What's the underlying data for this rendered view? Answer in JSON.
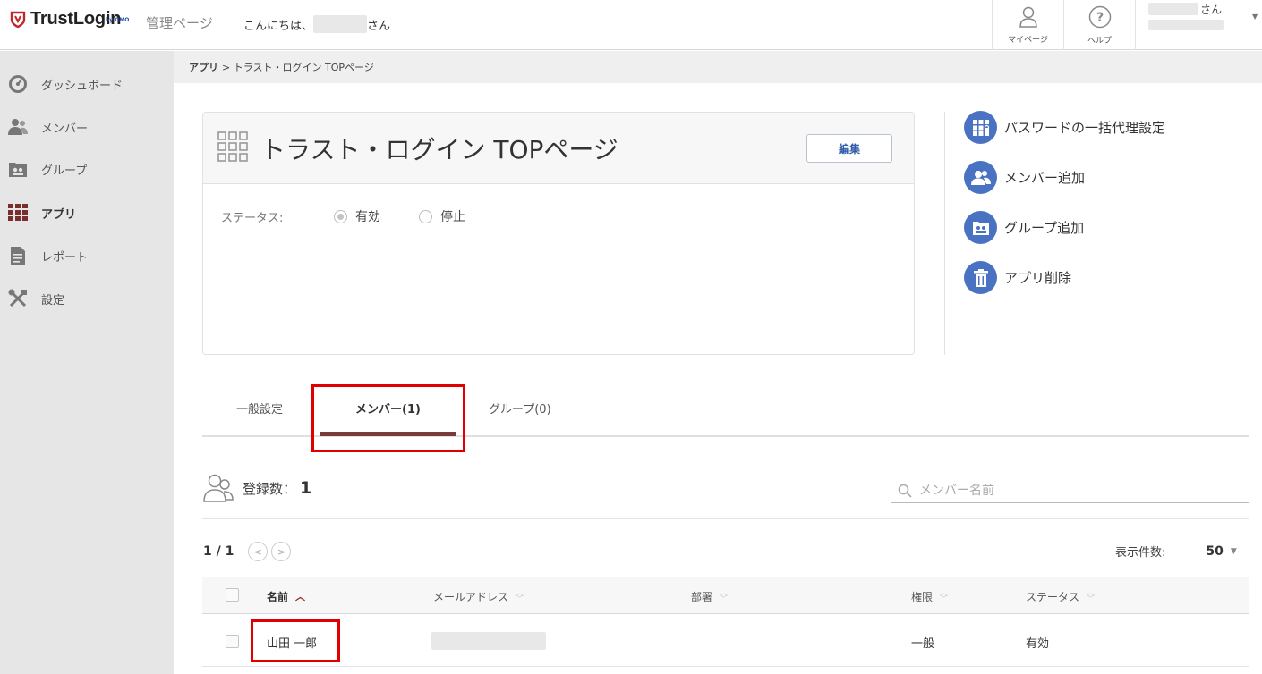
{
  "header": {
    "brand": "TrustLogin",
    "brand_sub": "by GMO",
    "admin_label": "管理ページ",
    "greeting_prefix": "こんにちは、",
    "greeting_suffix": "さん",
    "mypage_label": "マイページ",
    "help_label": "ヘルプ",
    "user_suffix": "さん"
  },
  "sidebar": {
    "items": [
      {
        "label": "ダッシュボード",
        "icon": "dashboard-icon"
      },
      {
        "label": "メンバー",
        "icon": "members-icon"
      },
      {
        "label": "グループ",
        "icon": "group-icon"
      },
      {
        "label": "アプリ",
        "icon": "apps-grid-icon",
        "active": true
      },
      {
        "label": "レポート",
        "icon": "report-icon"
      },
      {
        "label": "設定",
        "icon": "settings-tools-icon"
      }
    ]
  },
  "breadcrumb": {
    "parent": "アプリ",
    "current": "> トラスト・ログイン TOPページ"
  },
  "app": {
    "title": "トラスト・ログイン TOPページ",
    "edit_label": "編集",
    "status_label": "ステータス:",
    "status_options": [
      "有効",
      "停止"
    ],
    "status_selected": "有効"
  },
  "actions": [
    {
      "label": "パスワードの一括代理設定",
      "icon": "bulk-password-icon"
    },
    {
      "label": "メンバー追加",
      "icon": "add-member-icon"
    },
    {
      "label": "グループ追加",
      "icon": "add-group-icon"
    },
    {
      "label": "アプリ削除",
      "icon": "trash-icon"
    }
  ],
  "tabs": [
    {
      "label": "一般設定"
    },
    {
      "label": "メンバー(1)",
      "active": true
    },
    {
      "label": "グループ(0)"
    }
  ],
  "registration": {
    "label": "登録数：",
    "count": "1"
  },
  "search": {
    "placeholder": "メンバー名前"
  },
  "pager": {
    "page": "1 / 1",
    "prev": "<",
    "next": ">",
    "per_page_label": "表示件数:",
    "per_page_value": "50"
  },
  "table": {
    "columns": [
      "名前",
      "メールアドレス",
      "部署",
      "権限",
      "ステータス"
    ],
    "rows": [
      {
        "name": "山田 一郎",
        "email": "",
        "department": "",
        "role": "一般",
        "status": "有効"
      }
    ]
  },
  "colors": {
    "brand_red": "#c0272d",
    "accent_blue": "#4a72c2",
    "active_tab": "#7a3a3a",
    "highlight": "#e00000"
  }
}
